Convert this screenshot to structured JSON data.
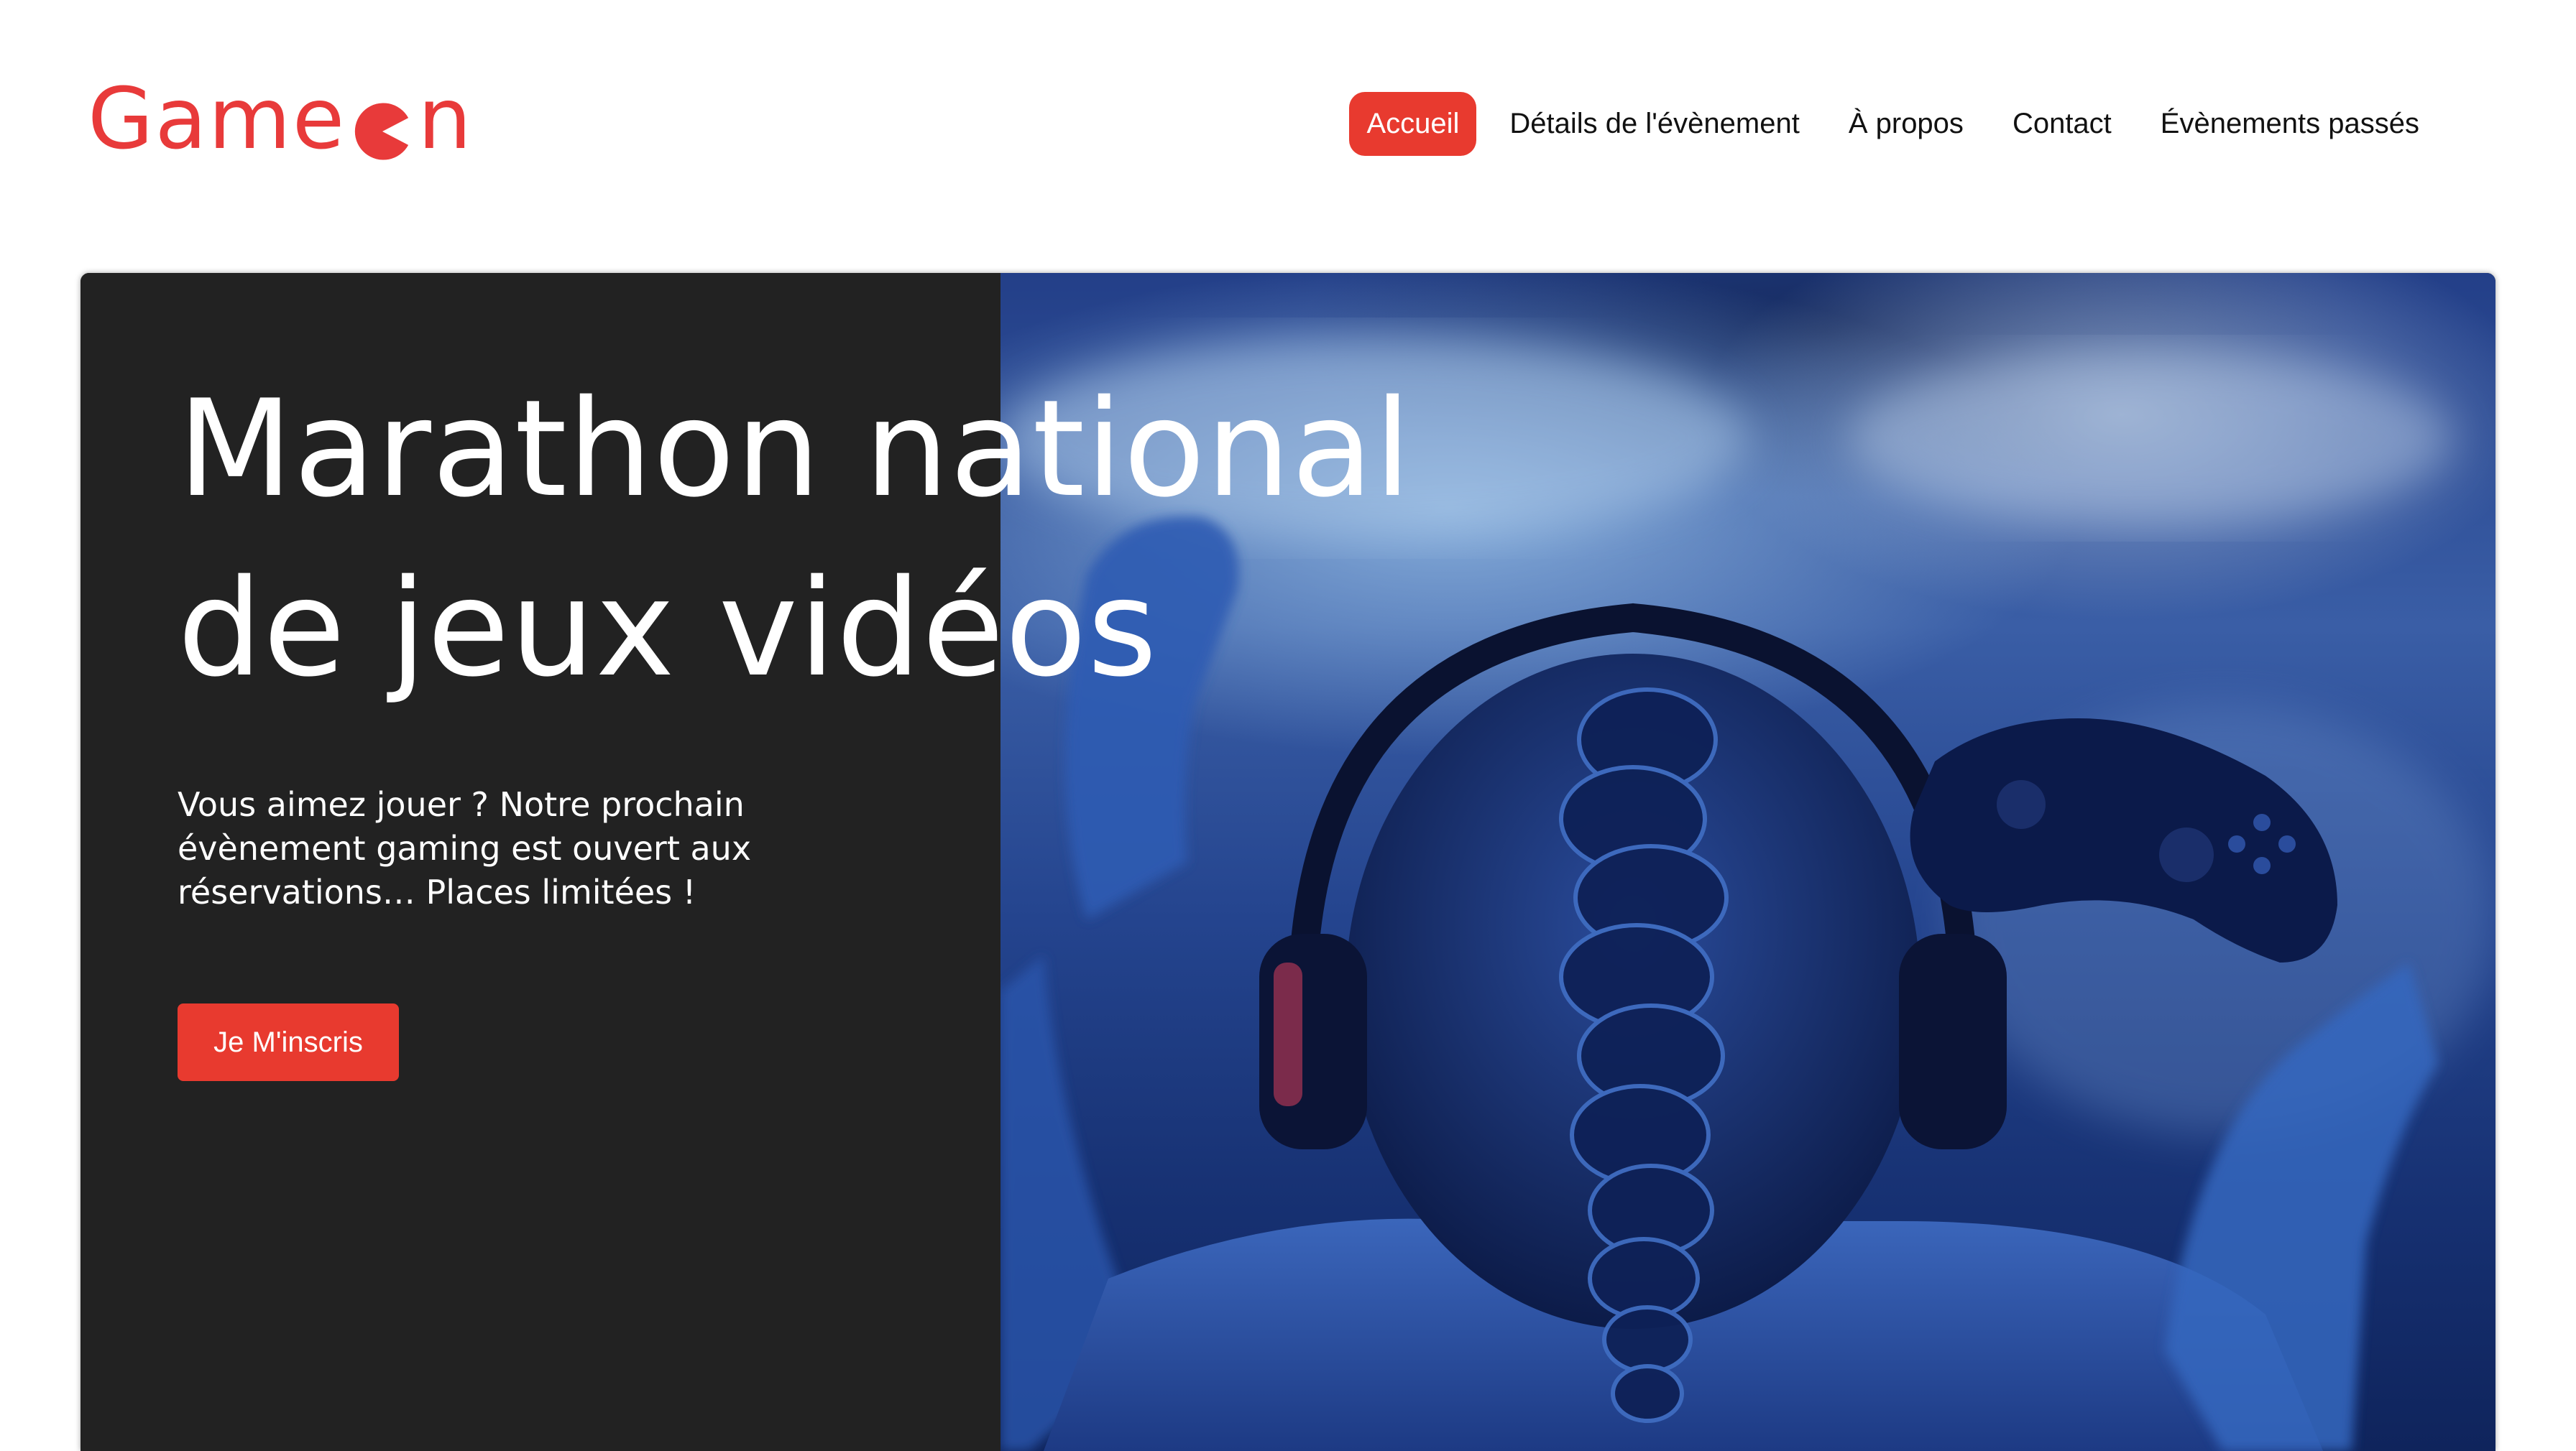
{
  "header": {
    "logo_text_start": "Game",
    "logo_text_end": "n",
    "logo_color": "#e83a3a",
    "nav": [
      {
        "label": "Accueil",
        "active": true
      },
      {
        "label": "Détails de l'évènement",
        "active": false
      },
      {
        "label": "À propos",
        "active": false
      },
      {
        "label": "Contact",
        "active": false
      },
      {
        "label": "Évènements passés",
        "active": false
      }
    ],
    "accent_color": "#e83a2f"
  },
  "hero": {
    "title_line1": "Marathon national",
    "title_line2": "de jeux vidéos",
    "text": "Vous aimez jouer ? Notre prochain évènement gaming est ouvert aux réservations… Places limitées !",
    "cta_label": "Je M'inscris",
    "panel_color": "#222222",
    "image_subject": "gamer-with-headphones-and-controller"
  }
}
